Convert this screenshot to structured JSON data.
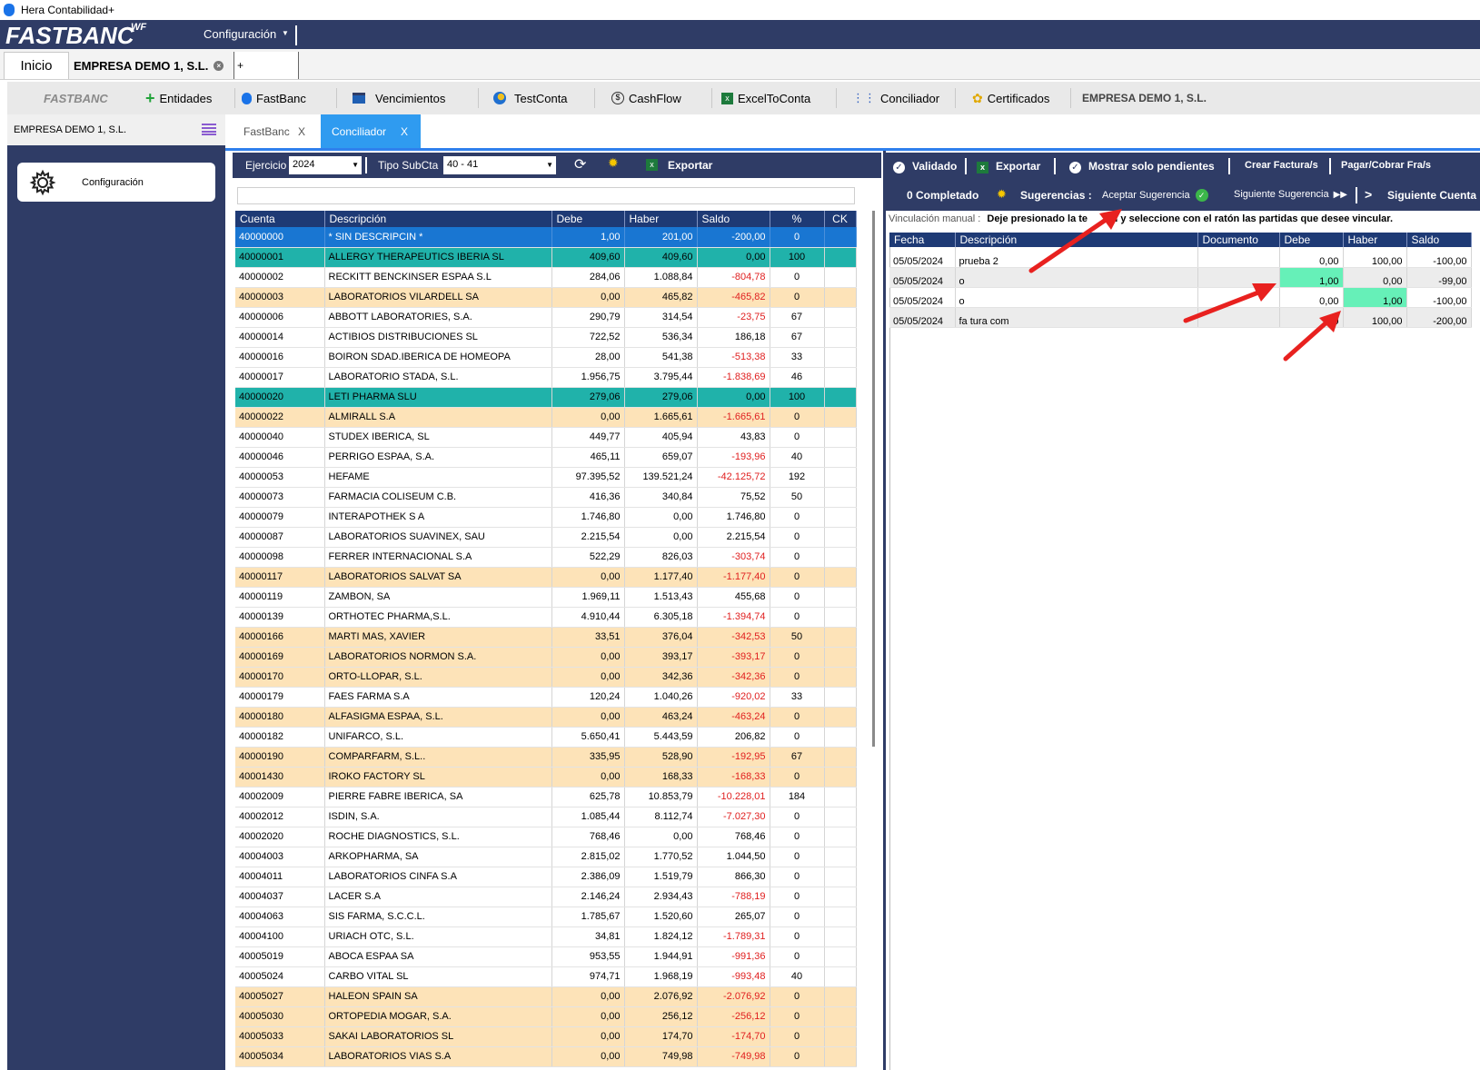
{
  "window": {
    "title": "Hera Contabilidad+"
  },
  "brand": {
    "name": "FASTBANC",
    "sup": "WF",
    "menu_config": "Configuración"
  },
  "doc_tabs": {
    "home": "Inicio",
    "company": "EMPRESA DEMO 1, S.L.",
    "new_tab": "+"
  },
  "modules": {
    "brand": "FASTBANC",
    "items": [
      "Entidades",
      "FastBanc",
      "Vencimientos",
      "TestConta",
      "CashFlow",
      "ExcelToConta",
      "Conciliador",
      "Certificados"
    ],
    "company": "EMPRESA DEMO 1, S.L."
  },
  "left_panel": {
    "company": "EMPRESA DEMO 1, S.L.",
    "config_label": "Configuración"
  },
  "content_tabs": [
    {
      "label": "FastBanc",
      "close": "X"
    },
    {
      "label": "Conciliador",
      "close": "X"
    }
  ],
  "left_toolbar": {
    "ejercicio_label": "Ejercicio",
    "ejercicio_value": "2024",
    "tipo_label": "Tipo SubCta",
    "tipo_value": "40 - 41",
    "export_label": "Exportar"
  },
  "accounts_table": {
    "columns": [
      "Cuenta",
      "Descripción",
      "Debe",
      "Haber",
      "Saldo",
      "%",
      "CK"
    ],
    "rows": [
      {
        "cuenta": "40000000",
        "desc": "* SIN DESCRIPCIN *",
        "debe": "1,00",
        "haber": "201,00",
        "saldo": "-200,00",
        "pct": "0",
        "ck": "",
        "style": "sel"
      },
      {
        "cuenta": "40000001",
        "desc": "ALLERGY THERAPEUTICS IBERIA SL",
        "debe": "409,60",
        "haber": "409,60",
        "saldo": "0,00",
        "pct": "100",
        "ck": "",
        "style": "teal"
      },
      {
        "cuenta": "40000002",
        "desc": "RECKITT BENCKINSER ESPAA S.L",
        "debe": "284,06",
        "haber": "1.088,84",
        "saldo": "-804,78",
        "pct": "0",
        "ck": "",
        "style": "white"
      },
      {
        "cuenta": "40000003",
        "desc": "LABORATORIOS VILARDELL SA",
        "debe": "0,00",
        "haber": "465,82",
        "saldo": "-465,82",
        "pct": "0",
        "ck": "",
        "style": "orange"
      },
      {
        "cuenta": "40000006",
        "desc": "ABBOTT LABORATORIES, S.A.",
        "debe": "290,79",
        "haber": "314,54",
        "saldo": "-23,75",
        "pct": "67",
        "ck": "",
        "style": "white"
      },
      {
        "cuenta": "40000014",
        "desc": "ACTIBIOS DISTRIBUCIONES SL",
        "debe": "722,52",
        "haber": "536,34",
        "saldo": "186,18",
        "pct": "67",
        "ck": "",
        "style": "white"
      },
      {
        "cuenta": "40000016",
        "desc": "BOIRON SDAD.IBERICA DE HOMEOPA",
        "debe": "28,00",
        "haber": "541,38",
        "saldo": "-513,38",
        "pct": "33",
        "ck": "",
        "style": "white"
      },
      {
        "cuenta": "40000017",
        "desc": "LABORATORIO STADA, S.L.",
        "debe": "1.956,75",
        "haber": "3.795,44",
        "saldo": "-1.838,69",
        "pct": "46",
        "ck": "",
        "style": "white"
      },
      {
        "cuenta": "40000020",
        "desc": "LETI PHARMA SLU",
        "debe": "279,06",
        "haber": "279,06",
        "saldo": "0,00",
        "pct": "100",
        "ck": "",
        "style": "teal"
      },
      {
        "cuenta": "40000022",
        "desc": "ALMIRALL S.A",
        "debe": "0,00",
        "haber": "1.665,61",
        "saldo": "-1.665,61",
        "pct": "0",
        "ck": "",
        "style": "orange"
      },
      {
        "cuenta": "40000040",
        "desc": "STUDEX IBERICA, SL",
        "debe": "449,77",
        "haber": "405,94",
        "saldo": "43,83",
        "pct": "0",
        "ck": "",
        "style": "white"
      },
      {
        "cuenta": "40000046",
        "desc": "PERRIGO ESPAA, S.A.",
        "debe": "465,11",
        "haber": "659,07",
        "saldo": "-193,96",
        "pct": "40",
        "ck": "",
        "style": "white"
      },
      {
        "cuenta": "40000053",
        "desc": "HEFAME",
        "debe": "97.395,52",
        "haber": "139.521,24",
        "saldo": "-42.125,72",
        "pct": "192",
        "ck": "",
        "style": "white"
      },
      {
        "cuenta": "40000073",
        "desc": "FARMACIA COLISEUM C.B.",
        "debe": "416,36",
        "haber": "340,84",
        "saldo": "75,52",
        "pct": "50",
        "ck": "",
        "style": "white"
      },
      {
        "cuenta": "40000079",
        "desc": "INTERAPOTHEK  S A",
        "debe": "1.746,80",
        "haber": "0,00",
        "saldo": "1.746,80",
        "pct": "0",
        "ck": "",
        "style": "white"
      },
      {
        "cuenta": "40000087",
        "desc": "LABORATORIOS SUAVINEX, SAU",
        "debe": "2.215,54",
        "haber": "0,00",
        "saldo": "2.215,54",
        "pct": "0",
        "ck": "",
        "style": "white"
      },
      {
        "cuenta": "40000098",
        "desc": "FERRER INTERNACIONAL S.A",
        "debe": "522,29",
        "haber": "826,03",
        "saldo": "-303,74",
        "pct": "0",
        "ck": "",
        "style": "white"
      },
      {
        "cuenta": "40000117",
        "desc": "LABORATORIOS SALVAT SA",
        "debe": "0,00",
        "haber": "1.177,40",
        "saldo": "-1.177,40",
        "pct": "0",
        "ck": "",
        "style": "orange"
      },
      {
        "cuenta": "40000119",
        "desc": "ZAMBON, SA",
        "debe": "1.969,11",
        "haber": "1.513,43",
        "saldo": "455,68",
        "pct": "0",
        "ck": "",
        "style": "white"
      },
      {
        "cuenta": "40000139",
        "desc": "ORTHOTEC PHARMA,S.L.",
        "debe": "4.910,44",
        "haber": "6.305,18",
        "saldo": "-1.394,74",
        "pct": "0",
        "ck": "",
        "style": "white"
      },
      {
        "cuenta": "40000166",
        "desc": "MARTI MAS, XAVIER",
        "debe": "33,51",
        "haber": "376,04",
        "saldo": "-342,53",
        "pct": "50",
        "ck": "",
        "style": "orange"
      },
      {
        "cuenta": "40000169",
        "desc": "LABORATORIOS NORMON S.A.",
        "debe": "0,00",
        "haber": "393,17",
        "saldo": "-393,17",
        "pct": "0",
        "ck": "",
        "style": "orange"
      },
      {
        "cuenta": "40000170",
        "desc": "ORTO-LLOPAR, S.L.",
        "debe": "0,00",
        "haber": "342,36",
        "saldo": "-342,36",
        "pct": "0",
        "ck": "",
        "style": "orange"
      },
      {
        "cuenta": "40000179",
        "desc": "FAES FARMA S.A",
        "debe": "120,24",
        "haber": "1.040,26",
        "saldo": "-920,02",
        "pct": "33",
        "ck": "",
        "style": "white"
      },
      {
        "cuenta": "40000180",
        "desc": "ALFASIGMA ESPAA, S.L.",
        "debe": "0,00",
        "haber": "463,24",
        "saldo": "-463,24",
        "pct": "0",
        "ck": "",
        "style": "orange"
      },
      {
        "cuenta": "40000182",
        "desc": "UNIFARCO, S.L.",
        "debe": "5.650,41",
        "haber": "5.443,59",
        "saldo": "206,82",
        "pct": "0",
        "ck": "",
        "style": "white"
      },
      {
        "cuenta": "40000190",
        "desc": "COMPARFARM, S.L..",
        "debe": "335,95",
        "haber": "528,90",
        "saldo": "-192,95",
        "pct": "67",
        "ck": "",
        "style": "orange"
      },
      {
        "cuenta": "40001430",
        "desc": "IROKO FACTORY SL",
        "debe": "0,00",
        "haber": "168,33",
        "saldo": "-168,33",
        "pct": "0",
        "ck": "",
        "style": "orange"
      },
      {
        "cuenta": "40002009",
        "desc": "PIERRE FABRE IBERICA, SA",
        "debe": "625,78",
        "haber": "10.853,79",
        "saldo": "-10.228,01",
        "pct": "184",
        "ck": "",
        "style": "white"
      },
      {
        "cuenta": "40002012",
        "desc": "ISDIN, S.A.",
        "debe": "1.085,44",
        "haber": "8.112,74",
        "saldo": "-7.027,30",
        "pct": "0",
        "ck": "",
        "style": "white"
      },
      {
        "cuenta": "40002020",
        "desc": "ROCHE DIAGNOSTICS, S.L.",
        "debe": "768,46",
        "haber": "0,00",
        "saldo": "768,46",
        "pct": "0",
        "ck": "",
        "style": "white"
      },
      {
        "cuenta": "40004003",
        "desc": "ARKOPHARMA, SA",
        "debe": "2.815,02",
        "haber": "1.770,52",
        "saldo": "1.044,50",
        "pct": "0",
        "ck": "",
        "style": "white"
      },
      {
        "cuenta": "40004011",
        "desc": "LABORATORIOS CINFA S.A",
        "debe": "2.386,09",
        "haber": "1.519,79",
        "saldo": "866,30",
        "pct": "0",
        "ck": "",
        "style": "white"
      },
      {
        "cuenta": "40004037",
        "desc": "LACER S.A",
        "debe": "2.146,24",
        "haber": "2.934,43",
        "saldo": "-788,19",
        "pct": "0",
        "ck": "",
        "style": "white"
      },
      {
        "cuenta": "40004063",
        "desc": "SIS FARMA, S.C.C.L.",
        "debe": "1.785,67",
        "haber": "1.520,60",
        "saldo": "265,07",
        "pct": "0",
        "ck": "",
        "style": "white"
      },
      {
        "cuenta": "40004100",
        "desc": "URIACH OTC, S.L.",
        "debe": "34,81",
        "haber": "1.824,12",
        "saldo": "-1.789,31",
        "pct": "0",
        "ck": "",
        "style": "white"
      },
      {
        "cuenta": "40005019",
        "desc": "ABOCA ESPAA SA",
        "debe": "953,55",
        "haber": "1.944,91",
        "saldo": "-991,36",
        "pct": "0",
        "ck": "",
        "style": "white"
      },
      {
        "cuenta": "40005024",
        "desc": "CARBO VITAL SL",
        "debe": "974,71",
        "haber": "1.968,19",
        "saldo": "-993,48",
        "pct": "40",
        "ck": "",
        "style": "white"
      },
      {
        "cuenta": "40005027",
        "desc": "HALEON SPAIN SA",
        "debe": "0,00",
        "haber": "2.076,92",
        "saldo": "-2.076,92",
        "pct": "0",
        "ck": "",
        "style": "orange"
      },
      {
        "cuenta": "40005030",
        "desc": "ORTOPEDIA MOGAR, S.A.",
        "debe": "0,00",
        "haber": "256,12",
        "saldo": "-256,12",
        "pct": "0",
        "ck": "",
        "style": "orange"
      },
      {
        "cuenta": "40005033",
        "desc": "SAKAI LABORATORIOS SL",
        "debe": "0,00",
        "haber": "174,70",
        "saldo": "-174,70",
        "pct": "0",
        "ck": "",
        "style": "orange"
      },
      {
        "cuenta": "40005034",
        "desc": "LABORATORIOS VIAS  S.A",
        "debe": "0,00",
        "haber": "749,98",
        "saldo": "-749,98",
        "pct": "0",
        "ck": "",
        "style": "orange"
      }
    ]
  },
  "right_toolbar": {
    "validado": "Validado",
    "exportar": "Exportar",
    "mostrar": "Mostrar solo pendientes",
    "crear": "Crear Factura/s",
    "pagar": "Pagar/Cobrar Fra/s",
    "completado": "0 Completado",
    "sugerencias": "Sugerencias :",
    "aceptar": "Aceptar Sugerencia",
    "siguiente_sug": "Siguiente Sugerencia",
    "siguiente_cuenta": "Siguiente Cuenta"
  },
  "vinculacion": {
    "label": "Vinculación manual :",
    "text_a": "Deje presionado la te",
    "text_b": "rl y seleccione con el ratón las partidas que desee vincular."
  },
  "moves_table": {
    "columns": [
      "Fecha",
      "Descripción",
      "Documento",
      "Debe",
      "Haber",
      "Saldo"
    ],
    "rows": [
      {
        "fecha": "05/05/2024",
        "desc": "prueba 2",
        "doc": "",
        "debe": "0,00",
        "haber": "100,00",
        "saldo": "-100,00",
        "style": "white",
        "green": ""
      },
      {
        "fecha": "05/05/2024",
        "desc": "o",
        "doc": "",
        "debe": "1,00",
        "haber": "0,00",
        "saldo": "-99,00",
        "style": "gray",
        "green": "debe"
      },
      {
        "fecha": "05/05/2024",
        "desc": "o",
        "doc": "",
        "debe": "0,00",
        "haber": "1,00",
        "saldo": "-100,00",
        "style": "white",
        "green": "haber"
      },
      {
        "fecha": "05/05/2024",
        "desc": "fa tura com",
        "doc": "",
        "debe": "0",
        "haber": "100,00",
        "saldo": "-200,00",
        "style": "gray",
        "green": ""
      }
    ]
  },
  "colors": {
    "navy": "#2f3c66",
    "header": "#1e3a75",
    "selected": "#1976d2",
    "teal": "#20b2aa",
    "orange": "#fde3b8",
    "green": "#66f0b8",
    "negative": "#e02020",
    "arrow": "#e8211f"
  }
}
